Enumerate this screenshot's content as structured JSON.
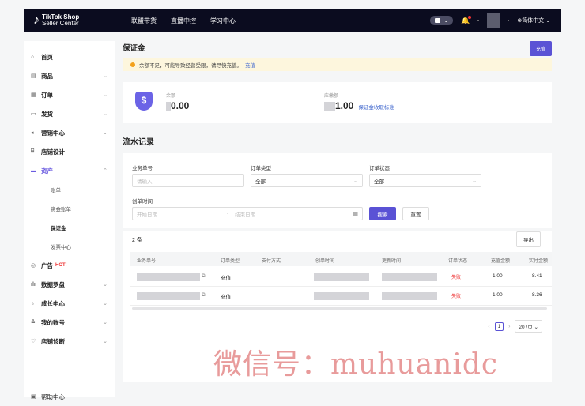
{
  "brand": {
    "line1": "TikTok Shop",
    "line2": "Seller Center"
  },
  "topnav": [
    "联盟带货",
    "直播中控",
    "学习中心"
  ],
  "lang": "简体中文",
  "sidebar": {
    "items": [
      {
        "label": "首页",
        "icon": "home-icon"
      },
      {
        "label": "商品",
        "icon": "goods-icon"
      },
      {
        "label": "订单",
        "icon": "orders-icon"
      },
      {
        "label": "发货",
        "icon": "truck-icon"
      },
      {
        "label": "营销中心",
        "icon": "megaphone-icon"
      },
      {
        "label": "店铺设计",
        "icon": "store-icon"
      },
      {
        "label": "资产",
        "icon": "wallet-icon"
      }
    ],
    "subitems": [
      "账单",
      "资金账单",
      "保证金",
      "发票中心"
    ],
    "items2": [
      {
        "label": "广告",
        "hot": "HOT!"
      },
      {
        "label": "数据罗盘"
      },
      {
        "label": "成长中心"
      },
      {
        "label": "我的账号"
      },
      {
        "label": "店铺诊断"
      }
    ],
    "help": "帮助中心"
  },
  "page": {
    "title": "保证金",
    "topbtn": "充值",
    "notice": "余额不足，可能导致经营受限，请尽快充值。",
    "notice_link": "充值",
    "bal_label1": "余额",
    "bal_val1": "0.00",
    "bal_label2": "应缴额",
    "bal_val2": "1.00",
    "bal_link": "保证金收取标准",
    "section": "流水记录"
  },
  "filters": {
    "f1": "业务单号",
    "f1_ph": "请输入",
    "f2": "订单类型",
    "f2_val": "全部",
    "f3": "订单状态",
    "f3_val": "全部",
    "f4": "创单时间",
    "f4_start": "开始日期",
    "f4_end": "结束日期",
    "search": "搜索",
    "reset": "重置"
  },
  "table": {
    "count": "2 条",
    "export": "导出",
    "headers": [
      "业务单号",
      "订单类型",
      "支付方式",
      "创单时间",
      "更新时间",
      "订单状态",
      "充值金额",
      "实付金额"
    ],
    "rows": [
      {
        "type": "充值",
        "pay": "--",
        "status": "失败",
        "amount": "1.00",
        "paid": "8.41"
      },
      {
        "type": "充值",
        "pay": "--",
        "status": "失败",
        "amount": "1.00",
        "paid": "8.36"
      }
    ],
    "page": "1",
    "pagesize": "20 /页"
  },
  "watermark": "微信号：muhuanidc"
}
